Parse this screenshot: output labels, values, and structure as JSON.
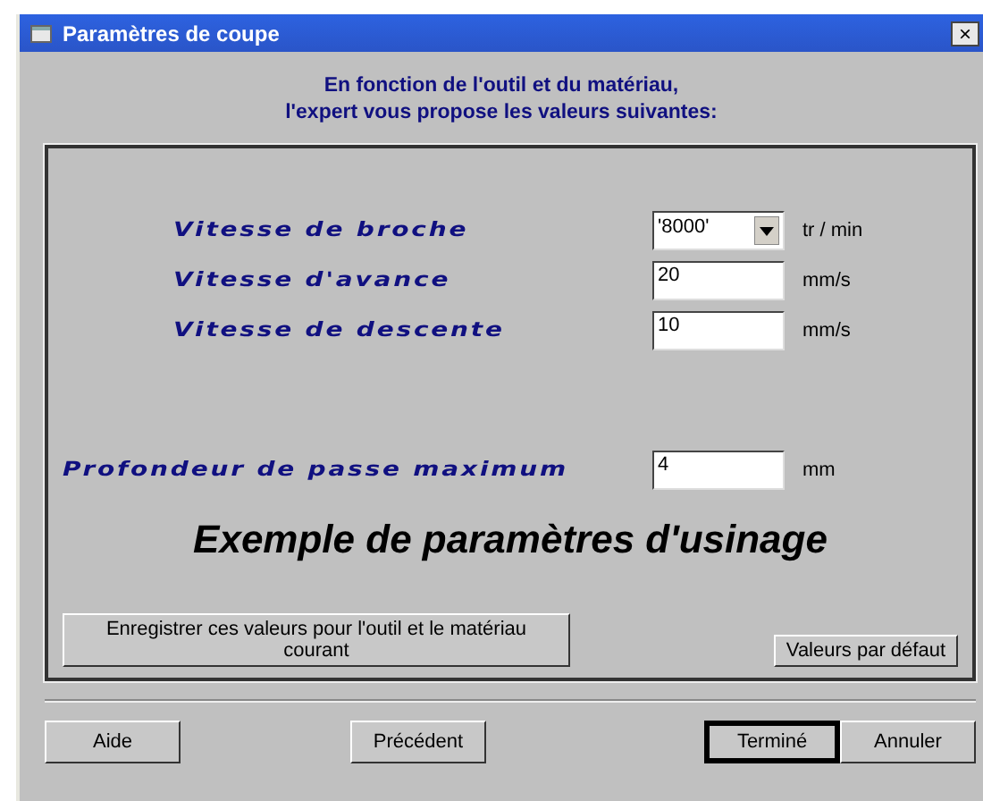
{
  "window": {
    "title": "Paramètres de coupe",
    "close": "×"
  },
  "intro": [
    "En fonction de l'outil et du matériau,",
    "l'expert vous propose les valeurs suivantes:"
  ],
  "fields": [
    {
      "label": "Vitesse de broche",
      "kind": "dropdown",
      "value": "'8000'",
      "unit": "tr / min"
    },
    {
      "label": "Vitesse d'avance",
      "kind": "text",
      "value": "20",
      "unit": "mm/s"
    },
    {
      "label": "Vitesse de descente",
      "kind": "text",
      "value": "10",
      "unit": "mm/s"
    },
    {
      "label": "Profondeur de passe maximum",
      "kind": "text",
      "value": "4",
      "unit": "mm"
    }
  ],
  "caption": "Exemple de paramètres d'usinage",
  "save_button": "Enregistrer ces valeurs pour l'outil et le matériau courant",
  "defaults_button": "Valeurs par défaut",
  "buttons": [
    {
      "label": "Aide",
      "default": false
    },
    {
      "label": "Précédent",
      "default": false
    },
    {
      "label": "Terminé",
      "default": true
    },
    {
      "label": "Annuler",
      "default": false
    }
  ]
}
